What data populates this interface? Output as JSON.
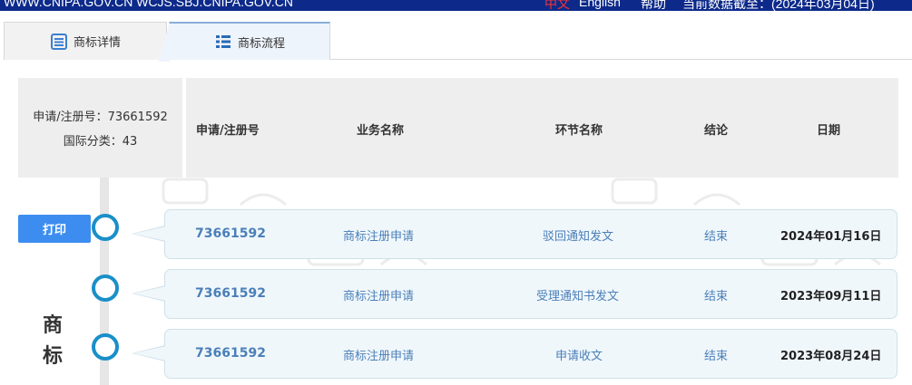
{
  "topbar": {
    "site": "WWW.CNIPA.GOV.CN  WCJS.SBJ.CNIPA.GOV.CN",
    "lang_cn": "中文",
    "lang_en": "English",
    "help": "帮助",
    "data_as_of": "当前数据截至：(2024年03月04日)"
  },
  "tabs": {
    "detail": "商标详情",
    "flow": "商标流程"
  },
  "summary": {
    "reg_no": "申请/注册号：73661592",
    "intl_class": "国际分类：43"
  },
  "columns": {
    "reg_no": "申请/注册号",
    "business": "业务名称",
    "step": "环节名称",
    "result": "结论",
    "date": "日期"
  },
  "print_label": "打印",
  "side_title": [
    "商",
    "标"
  ],
  "rows": [
    {
      "reg_no": "73661592",
      "business": "商标注册申请",
      "step": "驳回通知发文",
      "result": "结束",
      "date": "2024年01月16日"
    },
    {
      "reg_no": "73661592",
      "business": "商标注册申请",
      "step": "受理通知书发文",
      "result": "结束",
      "date": "2023年09月11日"
    },
    {
      "reg_no": "73661592",
      "business": "商标注册申请",
      "step": "申请收文",
      "result": "结束",
      "date": "2023年08月24日"
    }
  ],
  "colors": {
    "topbar": "#0d2a8a",
    "print_button": "#3d8df0",
    "timeline_node": "#1a8fc9",
    "link_text": "#4a7fb8",
    "row_bg": "#f0f7fb"
  },
  "icons": {
    "detail_tab": "document-list-icon",
    "flow_tab": "list-icon"
  }
}
